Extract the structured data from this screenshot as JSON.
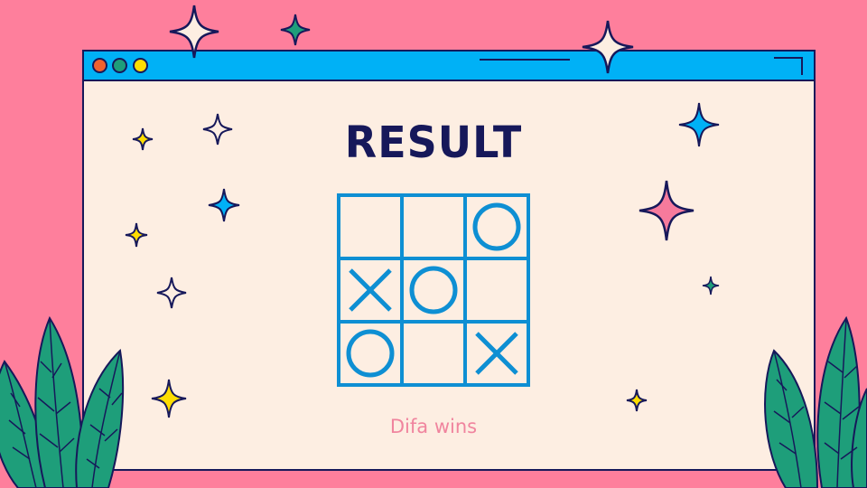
{
  "title": "RESULT",
  "winner_text": "Difa wins",
  "board": {
    "cells": [
      "",
      "",
      "O",
      "X",
      "O",
      "",
      "O",
      "",
      "X"
    ]
  },
  "window_controls": [
    "close",
    "minimize",
    "maximize"
  ],
  "colors": {
    "background": "#fe7f9c",
    "window": "#fdeee2",
    "titlebar": "#00b1f6",
    "outline": "#16185a",
    "grid": "#0e8fd3",
    "title_text": "#16185a",
    "winner_text": "#f0849e",
    "leaf": "#1e9e7a"
  }
}
